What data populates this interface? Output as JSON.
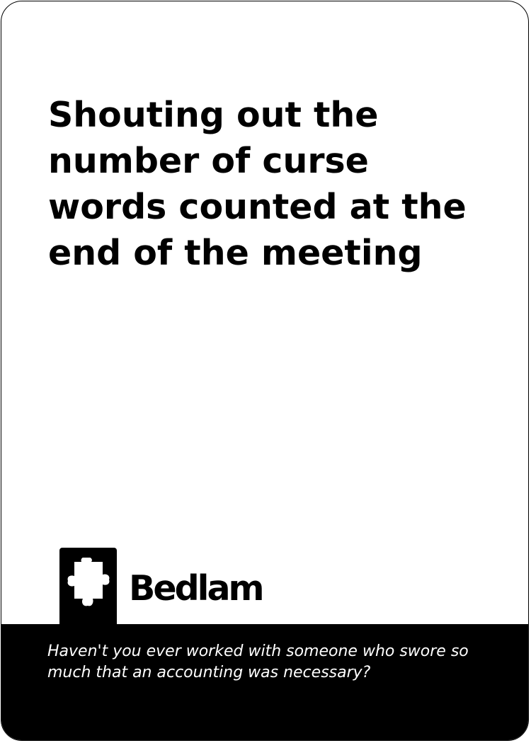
{
  "card": {
    "main_text": "Shouting out the number of curse words counted at the end of the meeting",
    "flavor_text": "Haven't you ever worked with someone who swore so much that an accounting was necessary?"
  },
  "brand": {
    "name": "Bedlam",
    "icon": "puzzle-piece-icon"
  },
  "colors": {
    "card_background": "#ffffff",
    "band": "#000000",
    "text": "#000000",
    "flavor_text": "#ffffff"
  }
}
